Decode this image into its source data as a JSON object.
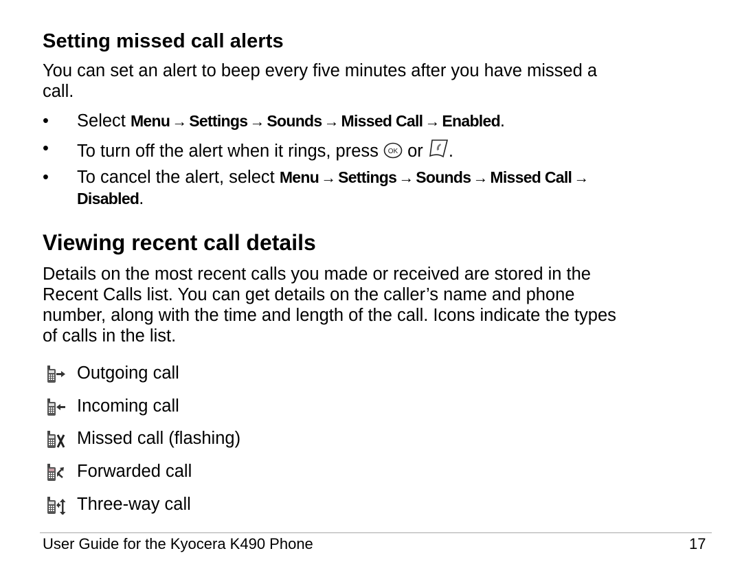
{
  "section1": {
    "heading": "Setting missed call alerts",
    "intro_line1": "You can set an alert to beep every five minutes after you have missed a",
    "intro_line2": "call.",
    "bullets": [
      {
        "prefix": "Select ",
        "path": [
          "Menu",
          "Settings",
          "Sounds",
          "Missed Call",
          "Enabled"
        ],
        "suffix": "."
      },
      {
        "text_before": "To turn off the alert when it rings, press ",
        "icon1": "ok-key-icon",
        "text_middle": " or ",
        "icon2": "send-key-icon",
        "text_after": "."
      },
      {
        "prefix": "To cancel the alert, select ",
        "path_line1": [
          "Menu",
          "Settings",
          "Sounds",
          "Missed Call"
        ],
        "path_line2": "Disabled",
        "suffix": "."
      }
    ],
    "bullet_char": "•",
    "arrow_char": "→"
  },
  "section2": {
    "heading": "Viewing recent call details",
    "paragraph_lines": [
      "Details on the most recent calls you made or received are stored in the",
      "Recent Calls list. You can get details on the caller’s name and phone",
      "number, along with the time and length of the call. Icons indicate the types",
      "of calls in the list."
    ],
    "call_types": [
      {
        "icon": "outgoing-call-icon",
        "label": "Outgoing call"
      },
      {
        "icon": "incoming-call-icon",
        "label": "Incoming call"
      },
      {
        "icon": "missed-call-icon",
        "label": "Missed call (flashing)"
      },
      {
        "icon": "forwarded-call-icon",
        "label": "Forwarded call"
      },
      {
        "icon": "three-way-call-icon",
        "label": "Three-way call"
      }
    ]
  },
  "footer": {
    "title": "User Guide for the Kyocera K490 Phone",
    "page_number": "17"
  }
}
